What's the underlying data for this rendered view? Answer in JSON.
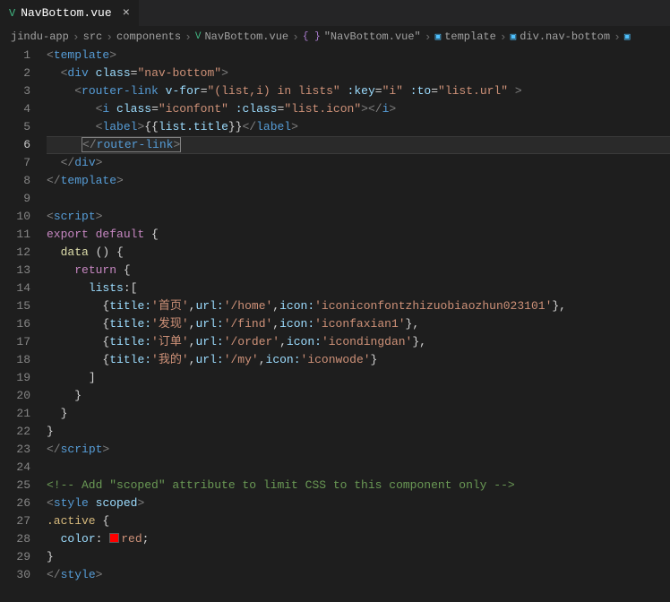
{
  "tab": {
    "icon": "V",
    "label": "NavBottom.vue",
    "close": "×"
  },
  "breadcrumbs": [
    {
      "text": "jindu-app"
    },
    {
      "text": "src"
    },
    {
      "text": "components"
    },
    {
      "icon": "vue",
      "text": "NavBottom.vue"
    },
    {
      "icon": "brace",
      "text": "\"NavBottom.vue\""
    },
    {
      "icon": "cube",
      "text": "template"
    },
    {
      "icon": "cube",
      "text": "div.nav-bottom"
    }
  ],
  "chevron": "›",
  "lineCount": 30,
  "activeLine": 6,
  "code": {
    "l1a": "<",
    "l1b": "template",
    "l1c": ">",
    "l2a": "<",
    "l2b": "div",
    "l2c": " ",
    "l2d": "class",
    "l2e": "=",
    "l2f": "\"nav-bottom\"",
    "l2g": ">",
    "l3a": "<",
    "l3b": "router-link",
    "l3c": " ",
    "l3d": "v-for",
    "l3e": "=",
    "l3f": "\"(list,i) in lists\"",
    "l3g": " ",
    "l3h": ":key",
    "l3i": "=",
    "l3j": "\"i\"",
    "l3k": " ",
    "l3l": ":to",
    "l3m": "=",
    "l3n": "\"list.url\"",
    "l3o": " >",
    "l4a": "<",
    "l4b": "i",
    "l4c": " ",
    "l4d": "class",
    "l4e": "=",
    "l4f": "\"iconfont\"",
    "l4g": " ",
    "l4h": ":class",
    "l4i": "=",
    "l4j": "\"list.icon\"",
    "l4k": "></",
    "l4l": "i",
    "l4m": ">",
    "l5a": "<",
    "l5b": "label",
    "l5c": ">",
    "l5d": "{{",
    "l5e": "list.title",
    "l5f": "}}",
    "l5g": "</",
    "l5h": "label",
    "l5i": ">",
    "l6a": "<",
    "l6aa": "/",
    "l6b": "router-link",
    "l6c": ">",
    "l7a": "</",
    "l7b": "div",
    "l7c": ">",
    "l8a": "</",
    "l8b": "template",
    "l8c": ">",
    "l10a": "<",
    "l10b": "script",
    "l10c": ">",
    "l11a": "export",
    "l11b": " ",
    "l11c": "default",
    "l11d": " {",
    "l12a": "data",
    "l12b": " () {",
    "l13a": "return",
    "l13b": " {",
    "l14a": "lists",
    "l14b": ":[",
    "l15a": "{",
    "l15b": "title:",
    "l15c": "'首页'",
    "l15d": ",",
    "l15e": "url:",
    "l15f": "'/home'",
    "l15g": ",",
    "l15h": "icon:",
    "l15i": "'iconiconfontzhizuobiaozhun023101'",
    "l15j": "},",
    "l16a": "{",
    "l16b": "title:",
    "l16c": "'发现'",
    "l16d": ",",
    "l16e": "url:",
    "l16f": "'/find'",
    "l16g": ",",
    "l16h": "icon:",
    "l16i": "'iconfaxian1'",
    "l16j": "},",
    "l17a": "{",
    "l17b": "title:",
    "l17c": "'订单'",
    "l17d": ",",
    "l17e": "url:",
    "l17f": "'/order'",
    "l17g": ",",
    "l17h": "icon:",
    "l17i": "'icondingdan'",
    "l17j": "},",
    "l18a": "{",
    "l18b": "title:",
    "l18c": "'我的'",
    "l18d": ",",
    "l18e": "url:",
    "l18f": "'/my'",
    "l18g": ",",
    "l18h": "icon:",
    "l18i": "'iconwode'",
    "l18j": "}",
    "l19a": "]",
    "l20a": "}",
    "l21a": "}",
    "l22a": "}",
    "l23a": "</",
    "l23b": "script",
    "l23c": ">",
    "l25a": "<!-- Add \"scoped\" attribute to limit CSS to this component only -->",
    "l26a": "<",
    "l26b": "style",
    "l26c": " ",
    "l26d": "scoped",
    "l26e": ">",
    "l27a": ".active",
    "l27b": " {",
    "l28a": "color",
    "l28b": ": ",
    "l28c": "red",
    "l28d": ";",
    "l29a": "}",
    "l30a": "</",
    "l30b": "style",
    "l30c": ">"
  }
}
